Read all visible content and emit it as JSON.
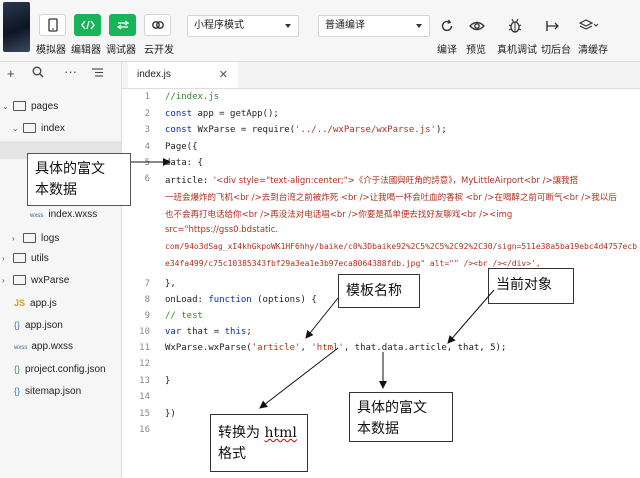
{
  "toolbar": {
    "simulator_label": "模拟器",
    "editor_label": "编辑器",
    "debugger_label": "调试器",
    "cloud_label": "云开发",
    "mode_select": "小程序模式",
    "compile_select": "普通编译",
    "compile_label": "编译",
    "preview_label": "预览",
    "realdebug_label": "真机调试",
    "background_label": "切后台",
    "clearcache_label": "清缓存",
    "accent_color": "#17b45a"
  },
  "sidebar": {
    "items": [
      {
        "label": "pages",
        "icon": "folder-icon"
      },
      {
        "label": "index",
        "icon": "folder-icon"
      },
      {
        "label": "index.wxss",
        "icon": "wxss-file-icon"
      },
      {
        "label": "logs",
        "icon": "folder-icon"
      },
      {
        "label": "utils",
        "icon": "folder-icon"
      },
      {
        "label": "wxParse",
        "icon": "folder-icon"
      },
      {
        "label": "app.js",
        "icon": "js-file-icon"
      },
      {
        "label": "app.json",
        "icon": "json-file-icon"
      },
      {
        "label": "app.wxss",
        "icon": "wxss-file-icon"
      },
      {
        "label": "project.config.json",
        "icon": "json-file-icon"
      },
      {
        "label": "sitemap.json",
        "icon": "json-file-icon"
      }
    ]
  },
  "editor": {
    "tab_label": "index.js",
    "line_numbers": [
      "1",
      "2",
      "3",
      "4",
      "5",
      "6",
      "7",
      "8",
      "9",
      "10",
      "11",
      "12",
      "13",
      "14",
      "15",
      "16"
    ],
    "lines": {
      "l1": "//index.js",
      "l2a": "const",
      "l2b": " app = getApp();",
      "l3a": "const",
      "l3b": " WxParse = require(",
      "l3c": "'../../wxParse/wxParse.js'",
      "l3d": ");",
      "l4": "Page({",
      "l5": "  data: {",
      "l6a": "    article: ",
      "l6b": "'<div style=\"text-align:center;\">《介于法國與旺角的詩意》，MyLittleAirport<br />讓我搭",
      "l6c": "一班会爆炸的飞机<br />去到台湾之前被炸死 <br />让我喝一杯会吐血的香槟 <br />在喝醉之前可断气<br />我以后",
      "l6d": "也不会再打电话给你<br />再没法对电话唱<br />你要是孤单便去找好友聊戏<br /><img",
      "l6e": "src=\"https://gss0.bdstatic.",
      "l6f": "com/94o3dSag_xI4khGkpoWK1HF6hhy/baike/c0%3Dbaike92%2C5%2C5%2C92%2C30/sign=511e38a5ba19ebc4d4757ecb",
      "l6g": "e34fa499/c75c10385343fbf29a3ea1e3b97eca8064388fdb.jpg\" alt=\"\" /><br /></div>',",
      "l7": "  },",
      "l8a": "  onLoad: ",
      "l8b": "function",
      "l8c": " (options) {",
      "l9": "    // test",
      "l10a": "    var",
      "l10b": " that = ",
      "l10c": "this",
      "l10d": ";",
      "l11a": "    WxParse.wxParse(",
      "l11b": "'article'",
      "l11c": ", ",
      "l11d": "'html'",
      "l11e": ", that.data.article, that, 5);",
      "l12": "",
      "l13": "  }",
      "l14": "",
      "l15": "})",
      "l16": ""
    }
  },
  "annotations": {
    "rich_text_top_l1": "具体的富文",
    "rich_text_top_l2": "本数据",
    "template_name": "模板名称",
    "current_object": "当前对象",
    "convert_l1a": "转换为 ",
    "convert_l1b": "html",
    "convert_l2": "格式",
    "rich_text_bottom_l1": "具体的富文",
    "rich_text_bottom_l2": "本数据"
  }
}
